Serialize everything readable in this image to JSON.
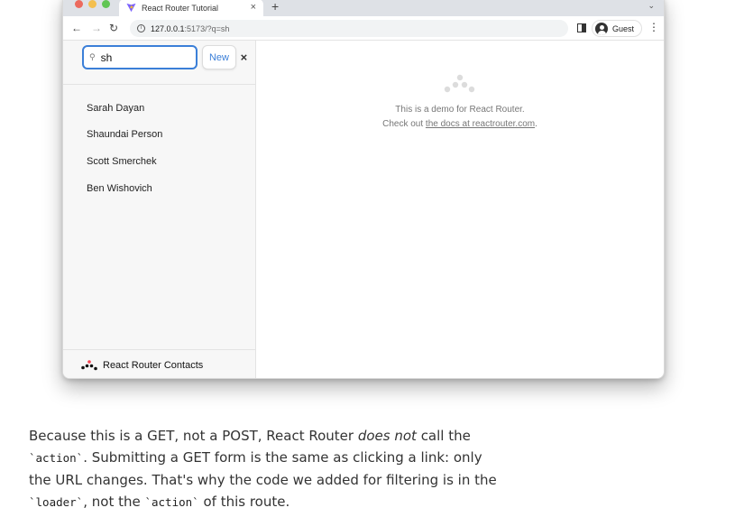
{
  "browser": {
    "tab_title": "React Router Tutorial",
    "tab_close": "×",
    "new_tab": "+",
    "tab_menu": "⌄",
    "url_host": "127.0.0.1",
    "url_path": ":5173/?q=sh",
    "profile_label": "Guest",
    "menu": "⋮",
    "back": "←",
    "forward": "→",
    "reload": "↻"
  },
  "sidebar": {
    "search_value": "sh",
    "search_icon": "search-icon",
    "clear_label": "×",
    "new_label": "New",
    "contacts": [
      "Sarah Dayan",
      "Shaundai Person",
      "Scott Smerchek",
      "Ben Wishovich"
    ],
    "footer_title": "React Router Contacts"
  },
  "detail": {
    "line1": "This is a demo for React Router.",
    "line2_prefix": "Check out ",
    "link_text": "the docs at reactrouter.com",
    "line2_suffix": "."
  },
  "paragraph": {
    "s1": "Because this is a GET, not a POST, React Router ",
    "s2_em": "does not",
    "s3": " call the ",
    "code_action": "`action`",
    "s4": ". Submitting a GET form is the same as clicking a link: only the URL changes. That's why the code we added for filtering is in the ",
    "code_loader": "`loader`",
    "s5": ", not the ",
    "code_action2": "`action`",
    "s6": " of this route."
  },
  "colors": {
    "accent": "#3b7fd8",
    "logo_red": "#f44250",
    "logo_dark": "#121212"
  }
}
